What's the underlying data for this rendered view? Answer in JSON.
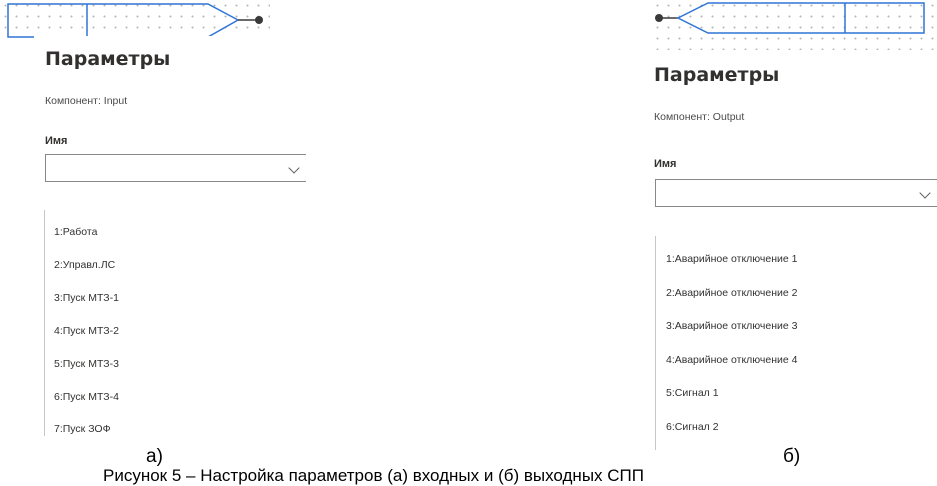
{
  "left": {
    "title": "Параметры",
    "component": "Компонент: Input",
    "name_label": "Имя",
    "select_value": "",
    "options": [
      "1:Работа",
      "2:Управл.ЛС",
      "3:Пуск МТЗ-1",
      "4:Пуск МТЗ-2",
      "5:Пуск МТЗ-3",
      "6:Пуск МТЗ-4",
      "7:Пуск ЗОФ"
    ],
    "caption": "а)"
  },
  "right": {
    "title": "Параметры",
    "component": "Компонент: Output",
    "name_label": "Имя",
    "select_value": "",
    "options": [
      "1:Аварийное отключение 1",
      "2:Аварийное отключение 2",
      "3:Аварийное отключение 3",
      "4:Аварийное отключение 4",
      "5:Сигнал 1",
      "6:Сигнал 2"
    ],
    "caption": "б)"
  },
  "footer": "Рисунок 5 – Настройка параметров (а) входных и (б) выходных СПП",
  "colors": {
    "block_stroke": "#2f75d6",
    "pin": "#3a3a3a",
    "dots": "#b8b8b8"
  },
  "icons": [
    "chevron-down-icon"
  ]
}
